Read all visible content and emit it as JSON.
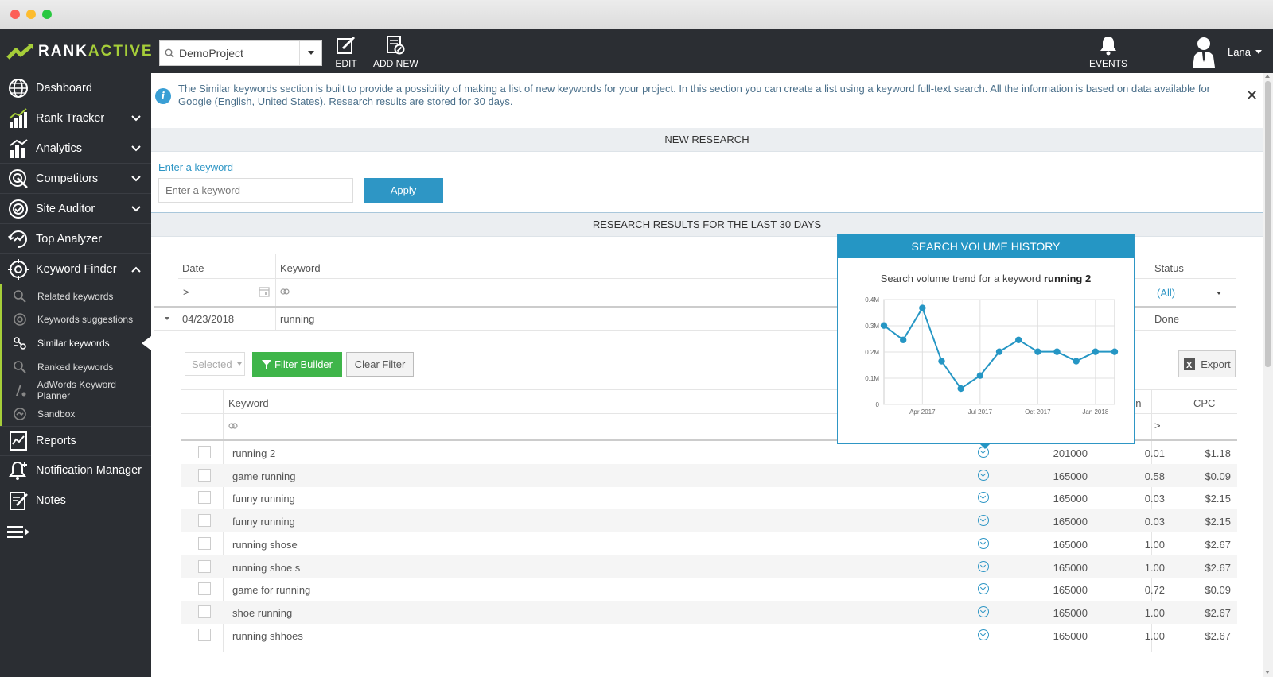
{
  "window": {
    "title": ""
  },
  "brand": {
    "name_white": "RANK",
    "name_green": "ACTIVE",
    "accent": "#a6ce39",
    "primary": "#2596c4"
  },
  "topbar": {
    "project": "DemoProject",
    "edit_label": "EDIT",
    "add_new_label": "ADD NEW",
    "events_label": "EVENTS",
    "user_name": "Lana"
  },
  "sidebar": {
    "items": [
      {
        "label": "Dashboard",
        "icon": "globe-icon"
      },
      {
        "label": "Rank Tracker",
        "icon": "rank-chart-icon"
      },
      {
        "label": "Analytics",
        "icon": "analytics-icon"
      },
      {
        "label": "Competitors",
        "icon": "target-icon"
      },
      {
        "label": "Site Auditor",
        "icon": "auditor-icon"
      },
      {
        "label": "Top Analyzer",
        "icon": "analyzer-icon"
      },
      {
        "label": "Keyword Finder",
        "icon": "keyword-finder-icon"
      }
    ],
    "sub_items": [
      {
        "label": "Related keywords"
      },
      {
        "label": "Keywords suggestions"
      },
      {
        "label": "Similar keywords"
      },
      {
        "label": "Ranked keywords"
      },
      {
        "label": "AdWords Keyword Planner"
      },
      {
        "label": "Sandbox"
      }
    ],
    "bottom_items": [
      {
        "label": "Reports"
      },
      {
        "label": "Notification Manager"
      },
      {
        "label": "Notes"
      }
    ]
  },
  "info": {
    "text": "The Similar keywords section is built to provide a possibility of making a list of new keywords for your project. In this section you can create a list using a keyword full-text search. All the information is based on data available for Google (English, United States). Research results are stored for 30 days."
  },
  "new_research": {
    "title": "NEW RESEARCH",
    "label": "Enter a keyword",
    "placeholder": "Enter a keyword",
    "apply": "Apply"
  },
  "results": {
    "title": "RESEARCH RESULTS FOR THE LAST 30 DAYS",
    "col_date": "Date",
    "col_keyword": "Keyword",
    "col_status": "Status",
    "date_filter": ">",
    "status_filter": "(All)",
    "row": {
      "date": "04/23/2018",
      "keyword": "running",
      "status": "Done"
    }
  },
  "inner": {
    "selected": "Selected",
    "filter_builder": "Filter Builder",
    "clear_filter": "Clear Filter",
    "export": "Export",
    "col_keyword": "Keyword",
    "col_comp_partial": "on",
    "col_cpc": "CPC",
    "cpc_filter": ">",
    "rows": [
      {
        "keyword": "running 2",
        "volume": "201000",
        "comp": "0.01",
        "cpc": "$1.18"
      },
      {
        "keyword": "game running",
        "volume": "165000",
        "comp": "0.58",
        "cpc": "$0.09"
      },
      {
        "keyword": "funny running",
        "volume": "165000",
        "comp": "0.03",
        "cpc": "$2.15"
      },
      {
        "keyword": "funny running",
        "volume": "165000",
        "comp": "0.03",
        "cpc": "$2.15"
      },
      {
        "keyword": "running shose",
        "volume": "165000",
        "comp": "1.00",
        "cpc": "$2.67"
      },
      {
        "keyword": "running shoe s",
        "volume": "165000",
        "comp": "1.00",
        "cpc": "$2.67"
      },
      {
        "keyword": "game for running",
        "volume": "165000",
        "comp": "0.72",
        "cpc": "$0.09"
      },
      {
        "keyword": "shoe running",
        "volume": "165000",
        "comp": "1.00",
        "cpc": "$2.67"
      },
      {
        "keyword": "running shhoes",
        "volume": "165000",
        "comp": "1.00",
        "cpc": "$2.67"
      }
    ]
  },
  "popup": {
    "title": "SEARCH VOLUME HISTORY",
    "subtitle_prefix": "Search volume trend for a keyword",
    "subtitle_keyword": "running 2"
  },
  "chart_data": {
    "type": "line",
    "title": "",
    "xlabel": "",
    "ylabel": "",
    "ylim": [
      0,
      400000
    ],
    "yticks": [
      "0",
      "0.1M",
      "0.2M",
      "0.3M",
      "0.4M"
    ],
    "xticks": [
      "Apr 2017",
      "Jul 2017",
      "Oct 2017",
      "Jan 2018"
    ],
    "x": [
      "Feb 2017",
      "Mar 2017",
      "Apr 2017",
      "May 2017",
      "Jun 2017",
      "Jul 2017",
      "Aug 2017",
      "Sep 2017",
      "Oct 2017",
      "Nov 2017",
      "Dec 2017",
      "Jan 2018",
      "Feb 2018"
    ],
    "series": [
      {
        "values": [
          301000,
          246000,
          368000,
          165000,
          60500,
          110000,
          201000,
          246000,
          201000,
          201000,
          165000,
          201000,
          201000
        ]
      }
    ],
    "grid": true,
    "color": "#2596c4"
  }
}
